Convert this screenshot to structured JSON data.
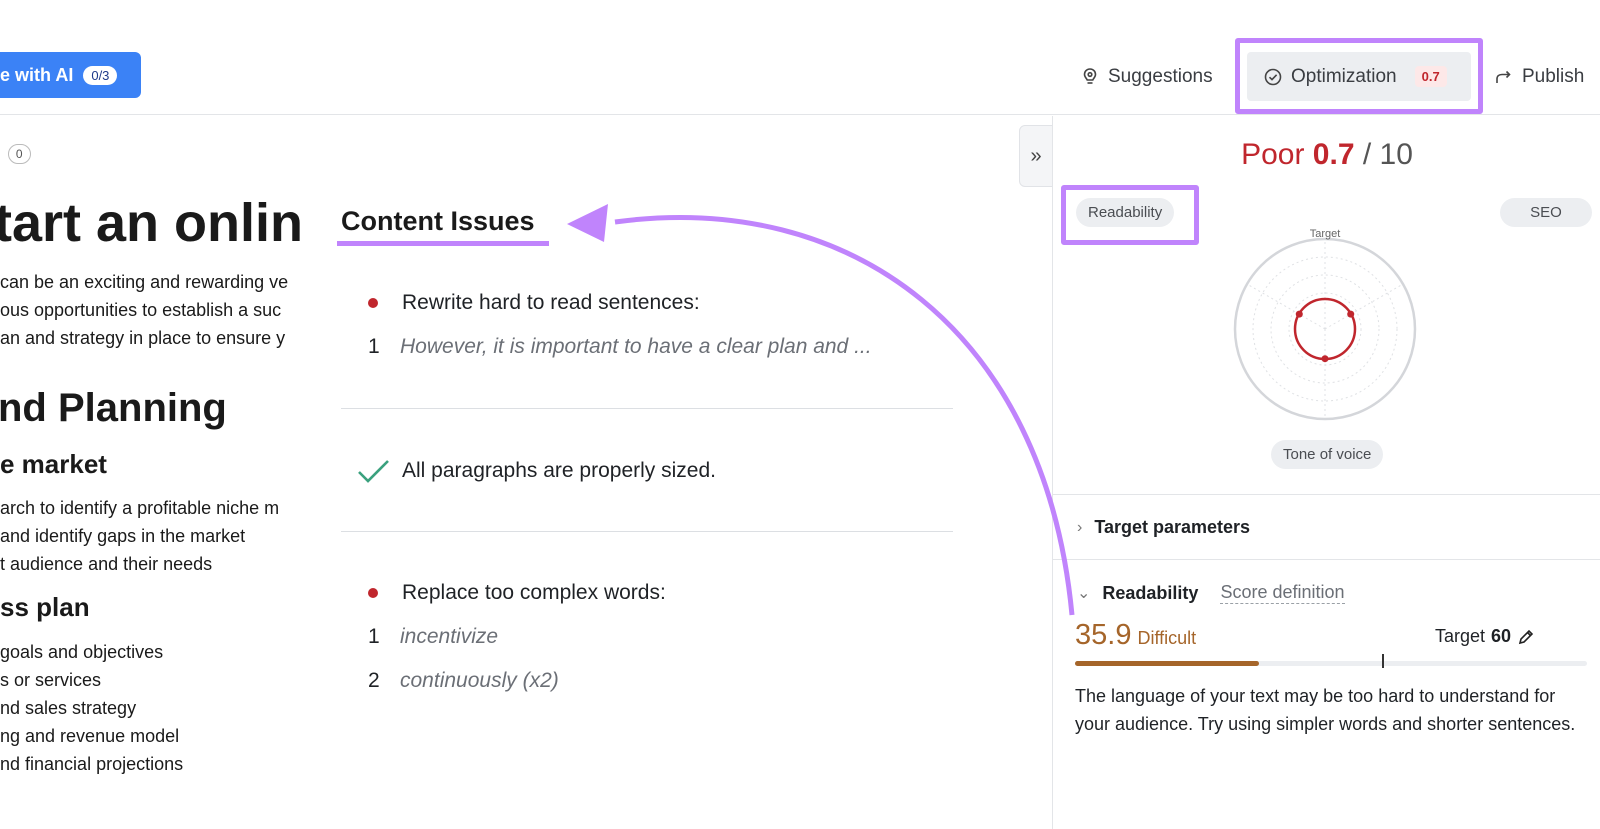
{
  "toolbar": {
    "ai_button_label": "e with AI",
    "ai_count": "0/3",
    "suggestions_label": "Suggestions",
    "optimization_label": "Optimization",
    "optimization_score": "0.7",
    "publish_label": "Publish"
  },
  "editor": {
    "counter_label": ":",
    "counter_value": "0",
    "title": "tart an onlin",
    "intro_lines": [
      "can be an exciting and rewarding ve",
      "ous opportunities to establish a suc",
      "an and strategy in place to ensure y"
    ],
    "section_heading": "nd Planning",
    "subheading_1": "e market",
    "list_1": [
      "arch to identify a profitable niche m",
      "and identify gaps in the market",
      "t audience and their needs"
    ],
    "subheading_2": "ss plan",
    "list_2": [
      "goals and objectives",
      "s or services",
      "nd sales strategy",
      "ng and revenue model",
      "nd financial projections"
    ]
  },
  "content_issues": {
    "title": "Content Issues",
    "issue_1_title": "Rewrite hard to read sentences:",
    "issue_1_items": [
      {
        "num": "1",
        "text": "However, it is important to have a clear plan and ..."
      }
    ],
    "issue_2_title": "All paragraphs are properly sized.",
    "issue_3_title": "Replace too complex words:",
    "issue_3_items": [
      {
        "num": "1",
        "text": "incentivize"
      },
      {
        "num": "2",
        "text": "continuously (x2)"
      }
    ]
  },
  "panel": {
    "score_word": "Poor",
    "score_value": "0.7",
    "score_max": "/ 10",
    "readability_pill": "Readability",
    "seo_pill": "SEO",
    "radar_target_label": "Target",
    "radar_values": [
      0.33,
      0.33,
      0.33
    ],
    "tone_pill": "Tone of voice",
    "target_params_label": "Target parameters",
    "readability_label": "Readability",
    "score_definition_label": "Score definition",
    "readability_score": "35.9",
    "readability_level": "Difficult",
    "readability_fraction": 0.359,
    "target_label": "Target",
    "target_value": "60",
    "target_fraction": 0.6,
    "description": "The language of your text may be too hard to understand for your audience. Try using simpler words and shorter sentences."
  },
  "colors": {
    "accent_blue": "#3b82f6",
    "highlight_purple": "#c084fc",
    "poor_red": "#c0262d",
    "difficult_brown": "#a5652a",
    "success_green": "#3aa17e"
  },
  "icons": {
    "suggestions": "lightbulb-icon",
    "optimization": "check-circle-icon",
    "publish": "share-arrow-icon",
    "collapse": "double-chevron-right-icon",
    "edit_target": "pencil-icon"
  }
}
